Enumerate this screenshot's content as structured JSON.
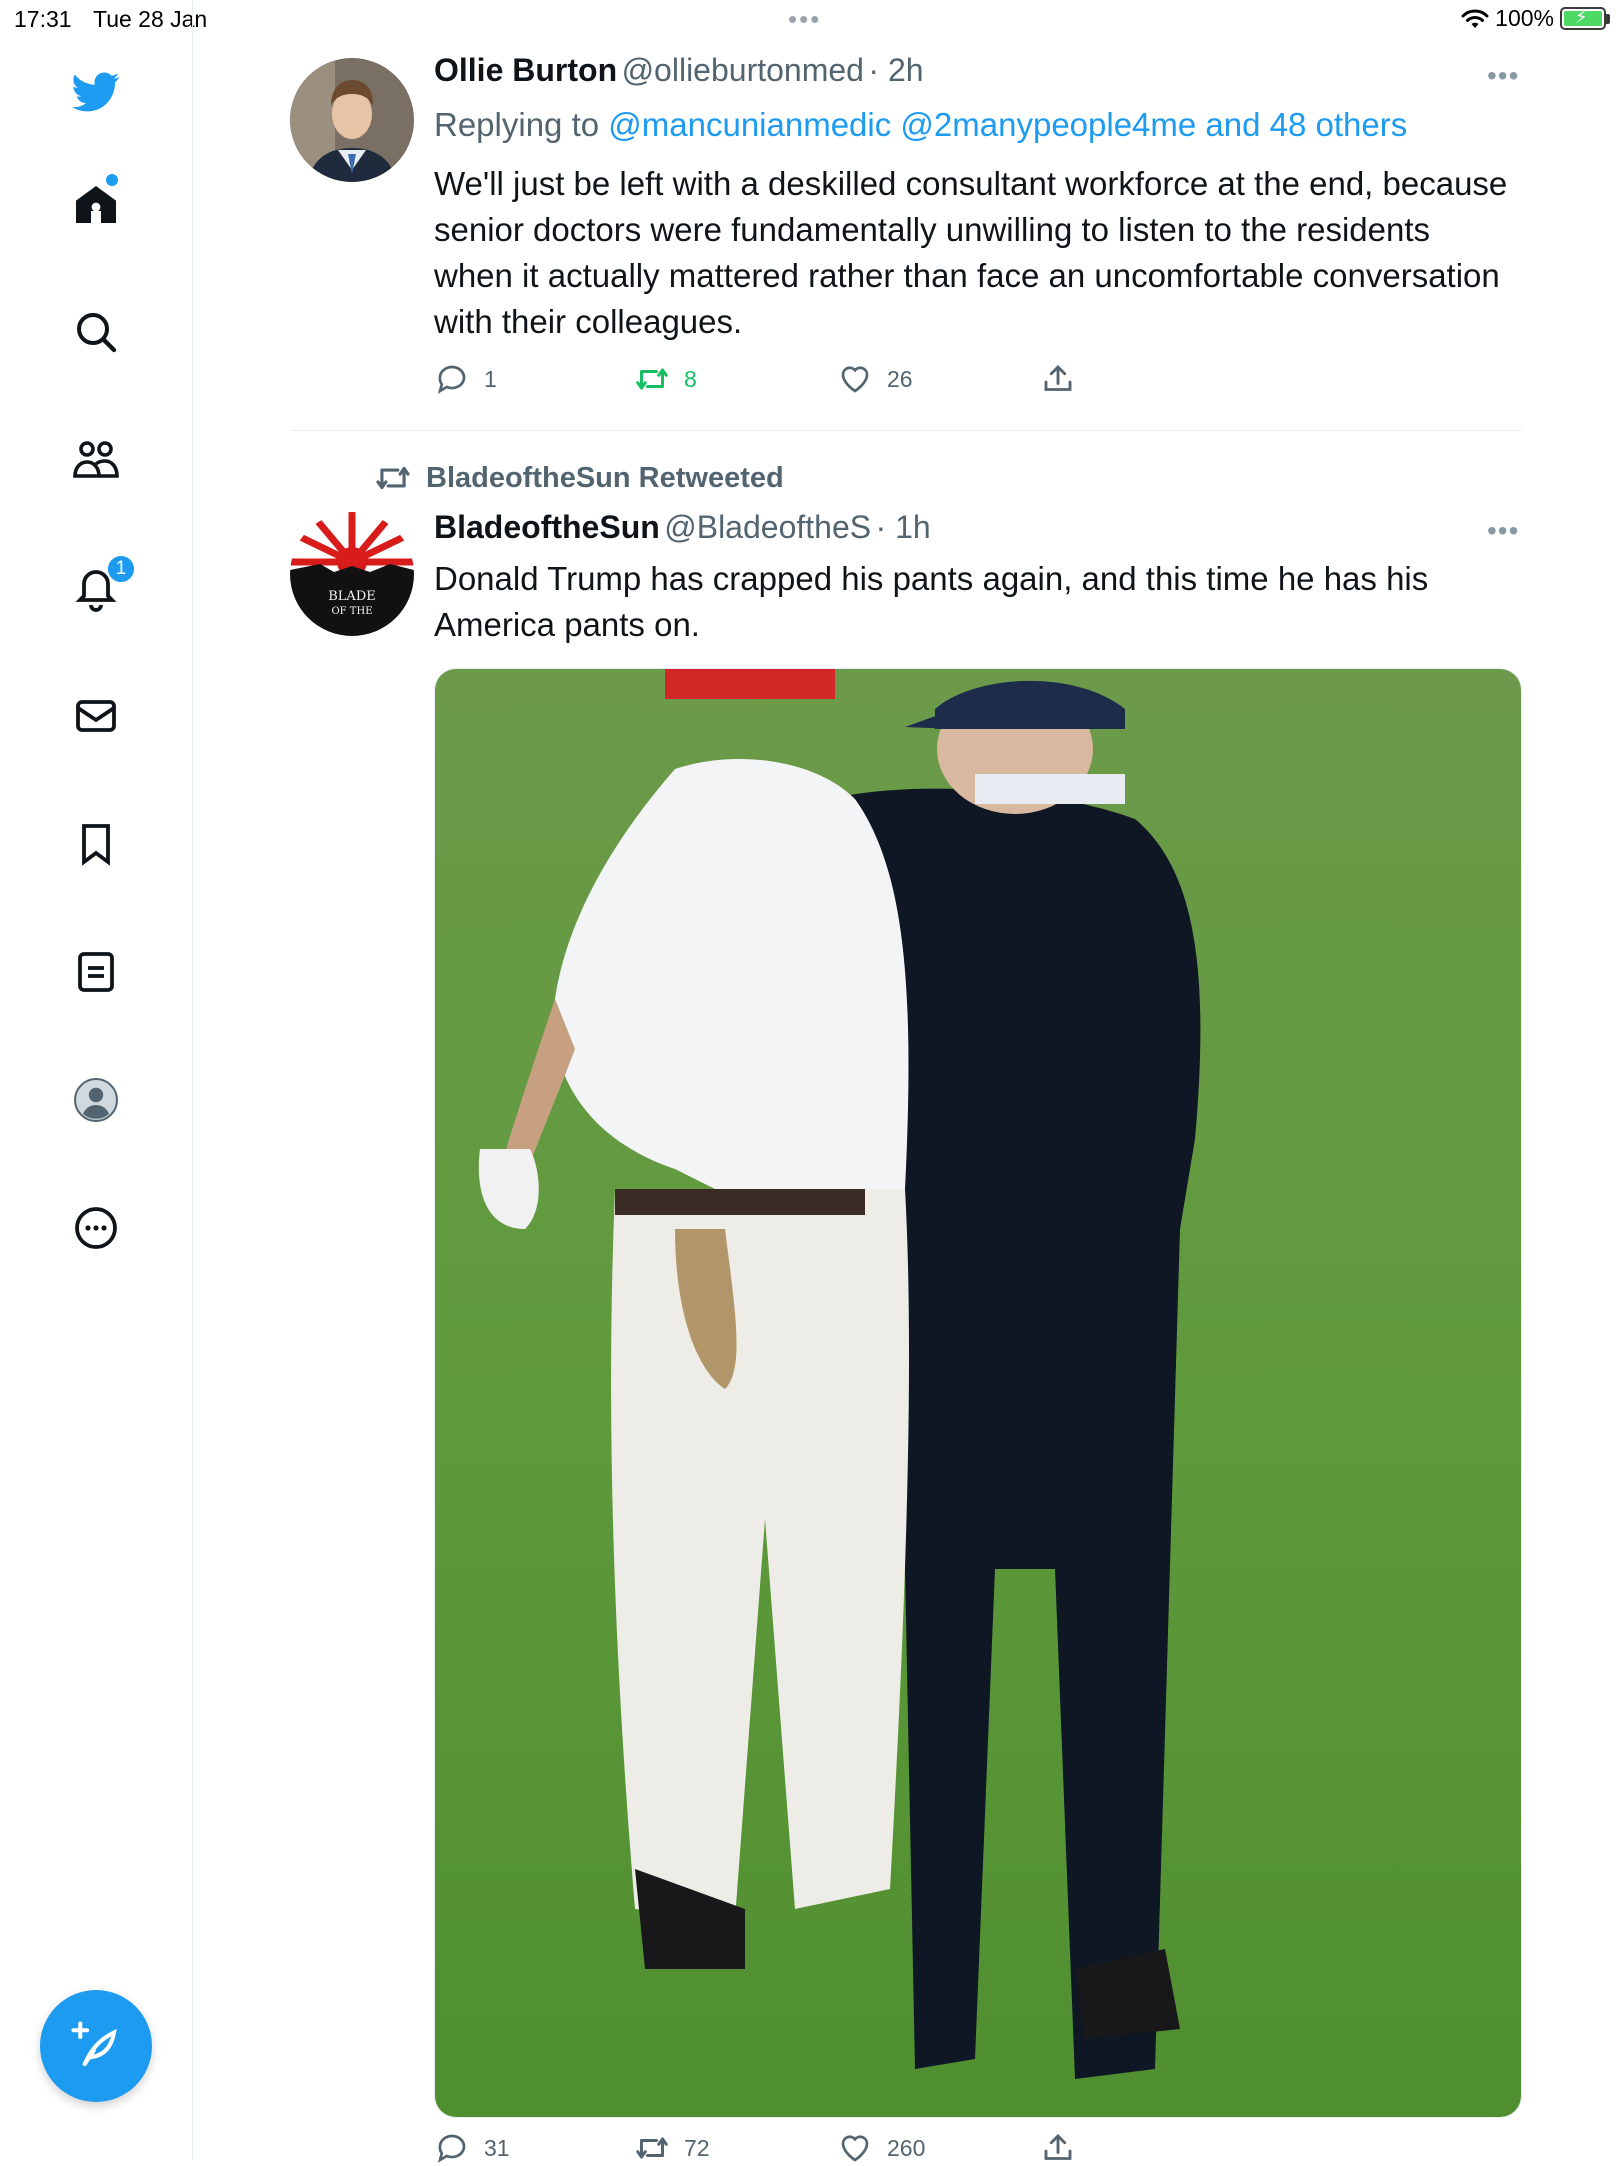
{
  "status_bar": {
    "time": "17:31",
    "date": "Tue 28 Jan",
    "multitask_dots": "•••",
    "battery_percent": "100%"
  },
  "sidebar": {
    "items": [
      {
        "name": "twitter-logo",
        "icon": "twitter-bird-icon"
      },
      {
        "name": "home",
        "icon": "home-icon"
      },
      {
        "name": "explore",
        "icon": "search-icon"
      },
      {
        "name": "communities",
        "icon": "people-icon"
      },
      {
        "name": "notifications",
        "icon": "bell-icon",
        "badge": "1"
      },
      {
        "name": "messages",
        "icon": "mail-icon"
      },
      {
        "name": "bookmarks",
        "icon": "bookmark-icon"
      },
      {
        "name": "lists",
        "icon": "list-icon"
      },
      {
        "name": "profile",
        "icon": "avatar-icon"
      },
      {
        "name": "more",
        "icon": "more-circle-icon"
      }
    ],
    "compose_icon": "compose-feather-icon"
  },
  "tweets": [
    {
      "name": "Ollie Burton",
      "handle": "@ollieburtonmed",
      "time": "· 2h",
      "replying_prefix": "Replying to",
      "replying_mentions": "@mancunianmedic @2manypeople4me and 48 others",
      "text": "We'll just be left with a deskilled consultant workforce at the end, because senior doctors were fundamentally unwilling to listen to the residents when it actually mattered rather than face an uncomfortable conversation with their colleagues.",
      "replies": "1",
      "retweets": "8",
      "likes": "26",
      "more": "•••"
    },
    {
      "retweeted_by": "BladeoftheSun Retweeted",
      "name": "BladeoftheSun",
      "handle": "@BladeoftheS",
      "time": "· 1h",
      "text": "Donald Trump has crapped his pants again, and this time he has his America pants on.",
      "avatar_text_1": "BLADE",
      "avatar_text_2": "OF THE",
      "replies": "31",
      "retweets": "72",
      "likes": "260",
      "more": "•••"
    }
  ],
  "colors": {
    "accent": "#1d9bf0",
    "retweet_green": "#17bf63",
    "secondary_text": "#536471"
  }
}
